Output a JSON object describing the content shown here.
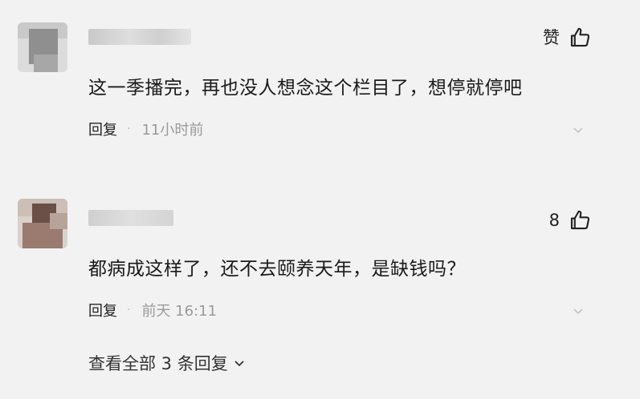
{
  "comments": [
    {
      "like_label": "赞",
      "text": "这一季播完，再也没人想念这个栏目了，想停就停吧",
      "reply_label": "回复",
      "separator": "·",
      "time": "11小时前"
    },
    {
      "like_label": "8",
      "text": "都病成这样了，还不去颐养天年，是缺钱吗？",
      "reply_label": "回复",
      "separator": "·",
      "time": "前天 16:11"
    }
  ],
  "view_replies": "查看全部 3 条回复",
  "icons": {
    "like": "thumb-up-icon",
    "more": "chevron-down-icon",
    "expand": "chevron-down-icon"
  },
  "colors": {
    "background": "#f2f2f2",
    "text": "#1a1a1a",
    "muted": "#9a9a9a"
  }
}
